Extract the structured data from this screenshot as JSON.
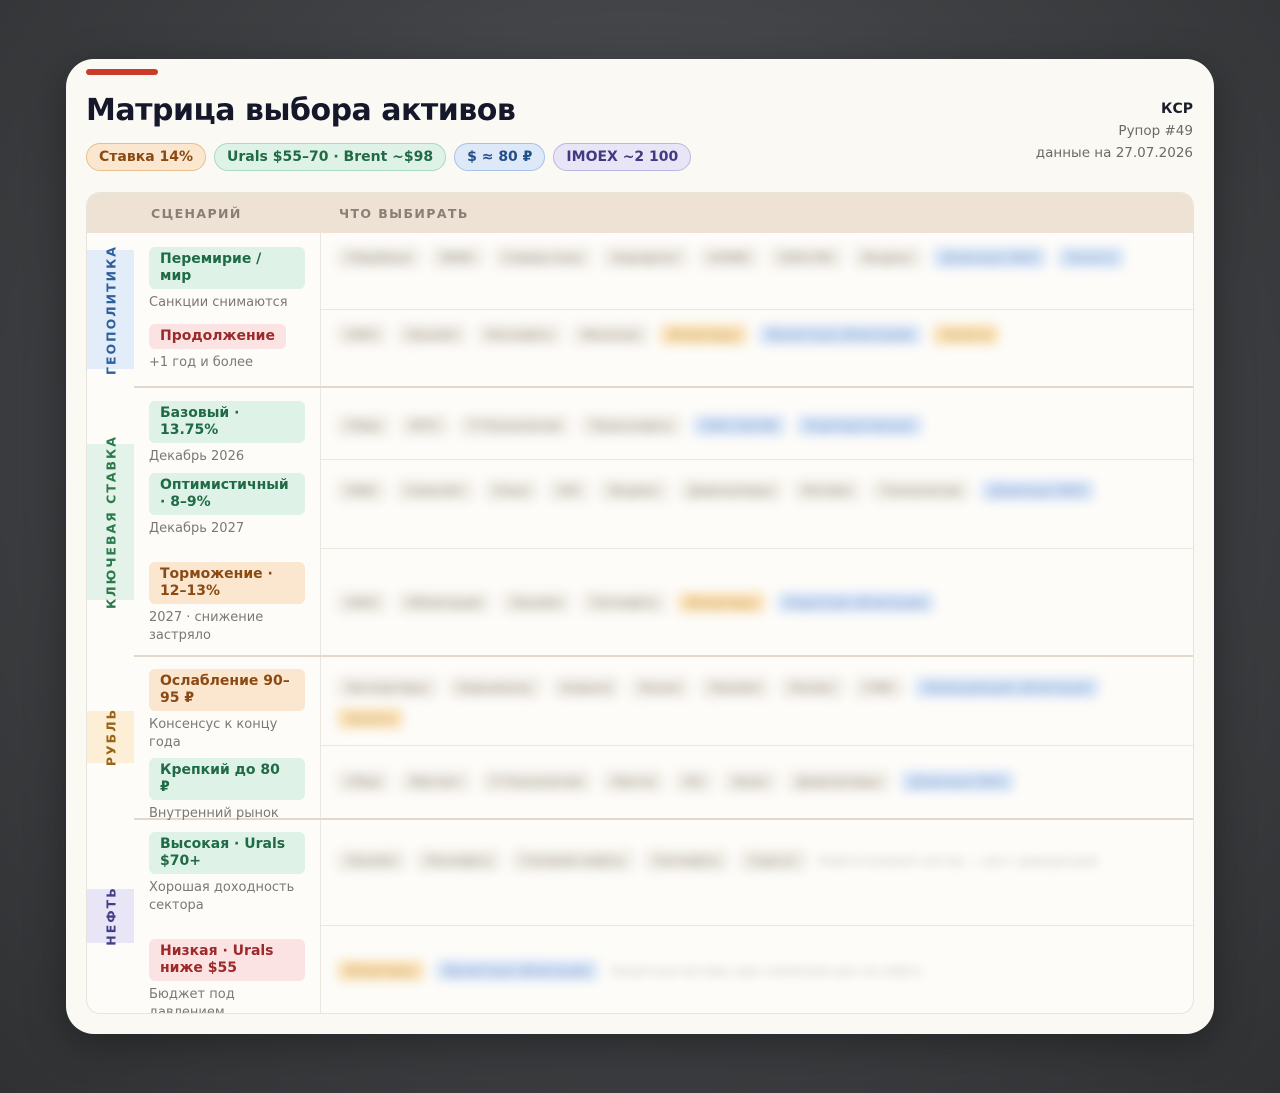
{
  "header": {
    "title": "Матрица выбора активов",
    "brand": "КСР",
    "issue": "Рупор #49",
    "date": "данные на 27.07.2026"
  },
  "chips": [
    {
      "label": "Ставка 14%",
      "bg": "#fbe7cf",
      "border": "#e9bf8e",
      "color": "#8b4a13"
    },
    {
      "label": "Urals $55–70 · Brent ~$98",
      "bg": "#dff2e8",
      "border": "#a9d9bf",
      "color": "#1f6b45"
    },
    {
      "label": "$ ≈ 80 ₽",
      "bg": "#dde9f8",
      "border": "#a7c2e6",
      "color": "#224f87"
    },
    {
      "label": "IMOEX ~2 100",
      "bg": "#e8e5f7",
      "border": "#bdb6e5",
      "color": "#413a82"
    }
  ],
  "table": {
    "col_scenario": "СЦЕНАРИЙ",
    "col_choice": "ЧТО ВЫБИРАТЬ"
  },
  "categories": [
    {
      "label": "ГЕОПОЛИТИКА",
      "bg": "#e2edf9",
      "color": "#2d5f9a"
    },
    {
      "label": "КЛЮЧЕВАЯ СТАВКА",
      "bg": "#e4f3ea",
      "color": "#2c7a4b"
    },
    {
      "label": "РУБЛЬ",
      "bg": "#fcefd6",
      "color": "#9a6416"
    },
    {
      "label": "НЕФТЬ",
      "bg": "#e8e6f6",
      "color": "#443d8a"
    }
  ],
  "scenarios": [
    {
      "name": "Перемирие / мир",
      "desc": "Санкции снимаются",
      "bg": "#dff2e8",
      "color": "#1f6b45",
      "assets": [
        {
          "t": "Сбербанк",
          "c": ""
        },
        {
          "t": "ММК",
          "c": ""
        },
        {
          "t": "Северсталь",
          "c": ""
        },
        {
          "t": "Аэрофлот",
          "c": ""
        },
        {
          "t": "НЛМК",
          "c": ""
        },
        {
          "t": "ОФЗ-ПК",
          "c": ""
        },
        {
          "t": "Яндекс",
          "c": ""
        },
        {
          "t": "Длинные ОФЗ",
          "c": "b"
        },
        {
          "t": "Золото",
          "c": "b"
        }
      ]
    },
    {
      "name": "Продолжение",
      "desc": "+1 год и более",
      "bg": "#fbe3e3",
      "color": "#9c2a2a",
      "assets": [
        {
          "t": "ОФЗ",
          "c": ""
        },
        {
          "t": "Лукойл",
          "c": ""
        },
        {
          "t": "Роснефть",
          "c": ""
        },
        {
          "t": "Фосагро",
          "c": ""
        },
        {
          "t": "Флоатеры",
          "c": "o"
        },
        {
          "t": "Валютные облигации",
          "c": "b"
        },
        {
          "t": "Золото",
          "c": "o"
        }
      ]
    },
    {
      "name": "Базовый · 13.75%",
      "desc": "Декабрь 2026",
      "bg": "#dff2e8",
      "color": "#1f6b45",
      "assets": [
        {
          "t": "Сбер",
          "c": ""
        },
        {
          "t": "МТС",
          "c": ""
        },
        {
          "t": "Т-Технологии",
          "c": ""
        },
        {
          "t": "Транснефть",
          "c": ""
        },
        {
          "t": "ОФЗ 26238",
          "c": "b"
        },
        {
          "t": "Корпоративные",
          "c": "b"
        }
      ]
    },
    {
      "name": "Оптимистичный · 8–9%",
      "desc": "Декабрь 2027",
      "bg": "#dff2e8",
      "color": "#1f6b45",
      "assets": [
        {
          "t": "ПИК",
          "c": ""
        },
        {
          "t": "Самолёт",
          "c": ""
        },
        {
          "t": "Озон",
          "c": ""
        },
        {
          "t": "HH",
          "c": ""
        },
        {
          "t": "Яндекс",
          "c": ""
        },
        {
          "t": "Девелоперы",
          "c": ""
        },
        {
          "t": "Ритейл",
          "c": ""
        },
        {
          "t": "Технологии",
          "c": ""
        },
        {
          "t": "Длинные ОФЗ",
          "c": "b"
        }
      ]
    },
    {
      "name": "Торможение · 12–13%",
      "desc": "2027 · снижение застряло",
      "bg": "#fbe7cf",
      "color": "#8b4a13",
      "assets": [
        {
          "t": "ОФЗ",
          "c": ""
        },
        {
          "t": "Облигации",
          "c": ""
        },
        {
          "t": "Лукойл",
          "c": ""
        },
        {
          "t": "Татнефть",
          "c": ""
        },
        {
          "t": "Флоатеры",
          "c": "o"
        },
        {
          "t": "Короткие облигации",
          "c": "b"
        }
      ]
    },
    {
      "name": "Ослабление 90–95 ₽",
      "desc": "Консенсус к концу года",
      "bg": "#fbe7cf",
      "color": "#8b4a13",
      "assets": [
        {
          "t": "Экспортёры",
          "c": ""
        },
        {
          "t": "Норникель",
          "c": ""
        },
        {
          "t": "Алроса",
          "c": ""
        },
        {
          "t": "Русал",
          "c": ""
        },
        {
          "t": "Лукойл",
          "c": ""
        },
        {
          "t": "Полюс",
          "c": ""
        },
        {
          "t": "ГМК",
          "c": ""
        },
        {
          "t": "Замещающие облигации",
          "c": "b"
        },
        {
          "t": "Золото",
          "c": "o"
        }
      ]
    },
    {
      "name": "Крепкий до 80 ₽",
      "desc": "Внутренний рынок",
      "bg": "#dff2e8",
      "color": "#1f6b45",
      "assets": [
        {
          "t": "Сбер",
          "c": ""
        },
        {
          "t": "Магнит",
          "c": ""
        },
        {
          "t": "Т-Технологии",
          "c": ""
        },
        {
          "t": "Лента",
          "c": ""
        },
        {
          "t": "X5",
          "c": ""
        },
        {
          "t": "Ozon",
          "c": ""
        },
        {
          "t": "Девелоперы",
          "c": ""
        },
        {
          "t": "Длинные ОФЗ",
          "c": "b"
        }
      ]
    },
    {
      "name": "Высокая · Urals $70+",
      "desc": "Хорошая доходность сектора",
      "bg": "#dff2e8",
      "color": "#1f6b45",
      "assets": [
        {
          "t": "Лукойл",
          "c": ""
        },
        {
          "t": "Роснефть",
          "c": ""
        },
        {
          "t": "Газпром нефть",
          "c": ""
        },
        {
          "t": "Татнефть",
          "c": ""
        },
        {
          "t": "Сургут",
          "c": ""
        },
        {
          "t": "Нефтегазовый сектор — рост дивидендов",
          "c": "t"
        }
      ]
    },
    {
      "name": "Низкая · Urals ниже $55",
      "desc": "Бюджет под давлением",
      "bg": "#fbe3e3",
      "color": "#9c2a2a",
      "assets": [
        {
          "t": "Флоатеры",
          "c": "o"
        },
        {
          "t": "Валютные облигации",
          "c": "b"
        },
        {
          "t": "Защитные активы при снижении цен на нефть",
          "c": "t"
        }
      ]
    }
  ]
}
